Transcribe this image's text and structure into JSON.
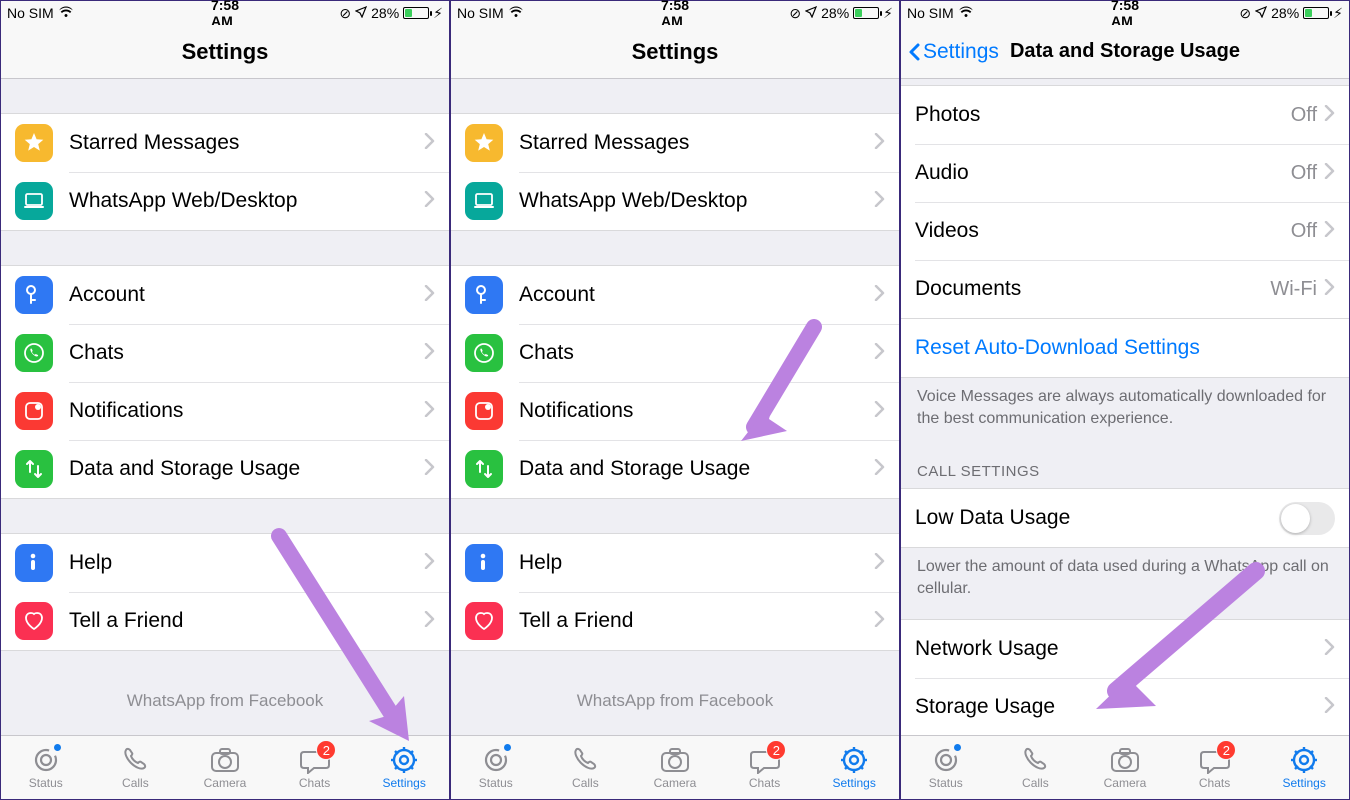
{
  "status": {
    "carrier": "No SIM",
    "time": "7:58 AM",
    "battery_pct": "28%"
  },
  "settings": {
    "title": "Settings",
    "group1": [
      {
        "label": "Starred Messages",
        "icon": "star",
        "color": "ic-yellow"
      },
      {
        "label": "WhatsApp Web/Desktop",
        "icon": "laptop",
        "color": "ic-teal"
      }
    ],
    "group2": [
      {
        "label": "Account",
        "icon": "key",
        "color": "ic-blue"
      },
      {
        "label": "Chats",
        "icon": "whatsapp",
        "color": "ic-green"
      },
      {
        "label": "Notifications",
        "icon": "bell",
        "color": "ic-red"
      },
      {
        "label": "Data and Storage Usage",
        "icon": "arrows",
        "color": "ic-arrows"
      }
    ],
    "group3": [
      {
        "label": "Help",
        "icon": "info",
        "color": "ic-info"
      },
      {
        "label": "Tell a Friend",
        "icon": "heart",
        "color": "ic-heart"
      }
    ],
    "brand": "WhatsApp from Facebook"
  },
  "data_usage": {
    "back_label": "Settings",
    "title": "Data and Storage Usage",
    "media_rows": [
      {
        "label": "Photos",
        "value": "Off"
      },
      {
        "label": "Audio",
        "value": "Off"
      },
      {
        "label": "Videos",
        "value": "Off"
      },
      {
        "label": "Documents",
        "value": "Wi-Fi"
      }
    ],
    "reset_label": "Reset Auto-Download Settings",
    "voice_note": "Voice Messages are always automatically downloaded for the best communication experience.",
    "call_header": "CALL SETTINGS",
    "low_data_label": "Low Data Usage",
    "low_data_note": "Lower the amount of data used during a WhatsApp call on cellular.",
    "usage_rows": [
      {
        "label": "Network Usage"
      },
      {
        "label": "Storage Usage"
      }
    ]
  },
  "tabs": {
    "items": [
      {
        "label": "Status",
        "icon": "status",
        "dot": true
      },
      {
        "label": "Calls",
        "icon": "calls"
      },
      {
        "label": "Camera",
        "icon": "camera"
      },
      {
        "label": "Chats",
        "icon": "chats",
        "badge": "2"
      },
      {
        "label": "Settings",
        "icon": "settings",
        "active": true
      }
    ]
  }
}
